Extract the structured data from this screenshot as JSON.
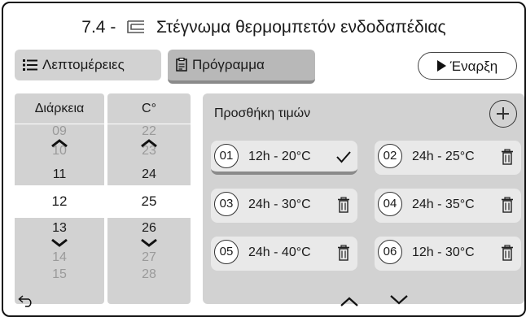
{
  "header": {
    "title_prefix": "7.4 -",
    "title_text": "Στέγνωμα θερμομπετόν ενδοδαπέδιας",
    "title_icon": "floor-heating-icon"
  },
  "tabs": [
    {
      "label": "Λεπτομέρειες",
      "icon": "list-icon",
      "active": false
    },
    {
      "label": "Πρόγραμμα",
      "icon": "clipboard-icon",
      "active": true
    }
  ],
  "start_button": {
    "label": "Έναρξη",
    "icon": "play-icon"
  },
  "duration_picker": {
    "header": "Διάρκεια",
    "values": [
      "09",
      "10",
      "11",
      "12",
      "13",
      "14",
      "15"
    ],
    "selected": "12"
  },
  "temperature_picker": {
    "header": "C°",
    "values": [
      "22",
      "23",
      "24",
      "25",
      "26",
      "27",
      "28"
    ],
    "selected": "25"
  },
  "program_panel": {
    "title": "Προσθήκη τιμών",
    "add_icon": "plus-circle-icon",
    "entries": [
      {
        "num": "01",
        "value": "12h - 20°C",
        "action": "check-icon",
        "active": true
      },
      {
        "num": "02",
        "value": "24h - 25°C",
        "action": "trash-icon",
        "active": false
      },
      {
        "num": "03",
        "value": "24h - 30°C",
        "action": "trash-icon",
        "active": false
      },
      {
        "num": "04",
        "value": "24h - 35°C",
        "action": "trash-icon",
        "active": false
      },
      {
        "num": "05",
        "value": "24h - 40°C",
        "action": "trash-icon",
        "active": false
      },
      {
        "num": "06",
        "value": "12h - 30°C",
        "action": "trash-icon",
        "active": false
      }
    ]
  },
  "footer": {
    "back_icon": "back-icon",
    "up_icon": "chevron-up-icon",
    "down_icon": "chevron-down-icon"
  }
}
